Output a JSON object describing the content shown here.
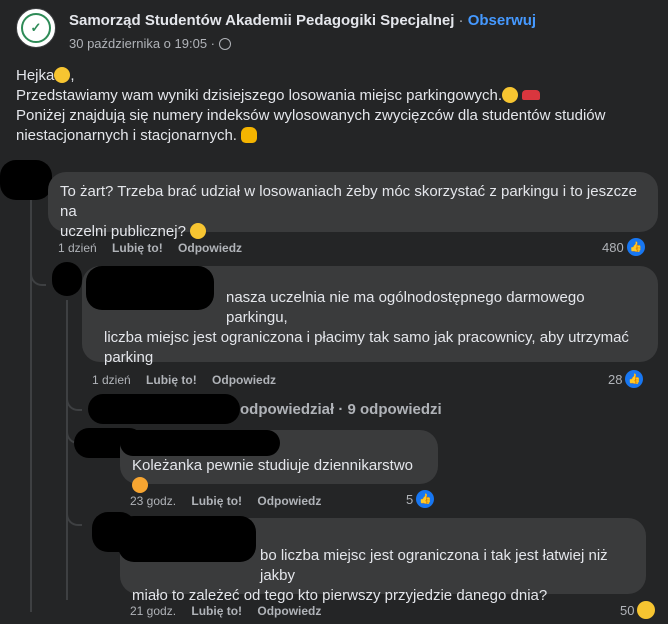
{
  "post": {
    "page_name": "Samorząd Studentów Akademii Pedagogiki Specjalnej",
    "separator": "·",
    "follow_label": "Obserwuj",
    "date": "30 października o 19:05 ·",
    "line1": "Hejka",
    "line2": "Przedstawiamy wam wyniki dzisiejszego losowania miejsc parkingowych.",
    "line3": "Poniżej znajdują się numery indeksów wylosowanych zwycięzców dla studentów studiów",
    "line4": "niestacjonarnych i stacjonarnych."
  },
  "comments": [
    {
      "text_line1": "To żart? Trzeba brać udział w losowaniach żeby móc skorzystać z parkingu i to jeszcze na",
      "text_line2": "uczelni publicznej?",
      "time": "1 dzień",
      "like_label": "Lubię to!",
      "reply_label": "Odpowiedz",
      "reactions": "480"
    },
    {
      "text_line1": "nasza uczelnia nie ma ogólnodostępnego darmowego parkingu,",
      "text_line2": "liczba miejsc jest ograniczona i płacimy tak samo jak pracownicy, aby utrzymać",
      "text_line3": "parking",
      "time": "1 dzień",
      "like_label": "Lubię to!",
      "reply_label": "Odpowiedz",
      "reactions": "28"
    },
    {
      "text": "Koleżanka pewnie studiuje dziennikarstwo",
      "time": "23 godz.",
      "like_label": "Lubię to!",
      "reply_label": "Odpowiedz",
      "reactions": "5"
    },
    {
      "text_line1": "bo liczba miejsc jest ograniczona i tak jest łatwiej niż jakby",
      "text_line2": "miało to zależeć od tego kto pierwszy przyjedzie danego dnia?",
      "time": "21 godz.",
      "like_label": "Lubię to!",
      "reply_label": "Odpowiedz",
      "reactions": "50"
    }
  ],
  "replies_summary": "odpowiedział · 9 odpowiedzi",
  "icons": {
    "globe": "globe-icon",
    "like": "like-reaction-icon",
    "haha": "haha-reaction-icon"
  },
  "colors": {
    "background": "#242526",
    "bubble": "#3a3b3c",
    "link": "#4599ff",
    "like_blue": "#1877f2"
  }
}
